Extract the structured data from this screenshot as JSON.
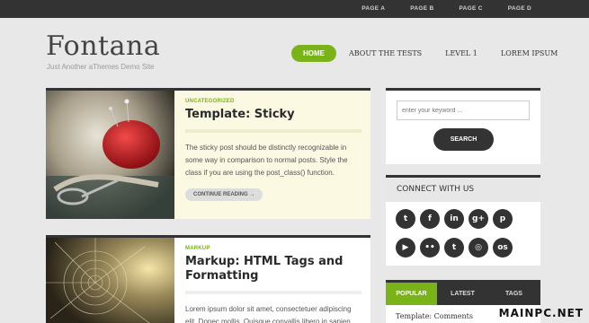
{
  "topbar": {
    "pages": [
      "PAGE A",
      "PAGE B",
      "PAGE C",
      "PAGE D"
    ]
  },
  "site": {
    "title": "Fontana",
    "tagline": "Just Another aThemes Demo Site"
  },
  "mainnav": {
    "items": [
      "HOME",
      "ABOUT THE TESTS",
      "LEVEL 1",
      "LOREM IPSUM"
    ],
    "active": "HOME"
  },
  "posts": [
    {
      "category": "UNCATEGORIZED",
      "title": "Template: Sticky",
      "excerpt": "The sticky post should be distinctly recognizable in some way in comparison to normal posts. Style the class if you are using the post_class() function.",
      "more": "CONTINUE READING →"
    },
    {
      "category": "MARKUP",
      "title": "Markup: HTML Tags and Formatting",
      "excerpt": "Lorem ipsum dolor sit amet, consectetuer adipiscing elit. Donec mollis. Quisque convallis libero in sapien"
    }
  ],
  "search": {
    "placeholder": "enter your keyword ...",
    "button": "SEARCH"
  },
  "connect": {
    "title": "CONNECT WITH US",
    "icons": [
      "twitter-icon",
      "facebook-icon",
      "linkedin-icon",
      "google-plus-icon",
      "pinterest-icon",
      "youtube-icon",
      "flickr-icon",
      "tumblr-icon",
      "instagram-icon",
      "lastfm-icon"
    ],
    "glyphs": [
      "t",
      "f",
      "in",
      "g+",
      "p",
      "▶",
      "••",
      "t",
      "◎",
      "os"
    ]
  },
  "tabs_widget": {
    "tabs": [
      "POPULAR",
      "LATEST",
      "TAGS"
    ],
    "first_item": "Template: Comments"
  },
  "watermark": "MAINPC.NET",
  "colors": {
    "accent": "#7ab317",
    "dark": "#333333",
    "sticky_bg": "#fbf9e2"
  }
}
